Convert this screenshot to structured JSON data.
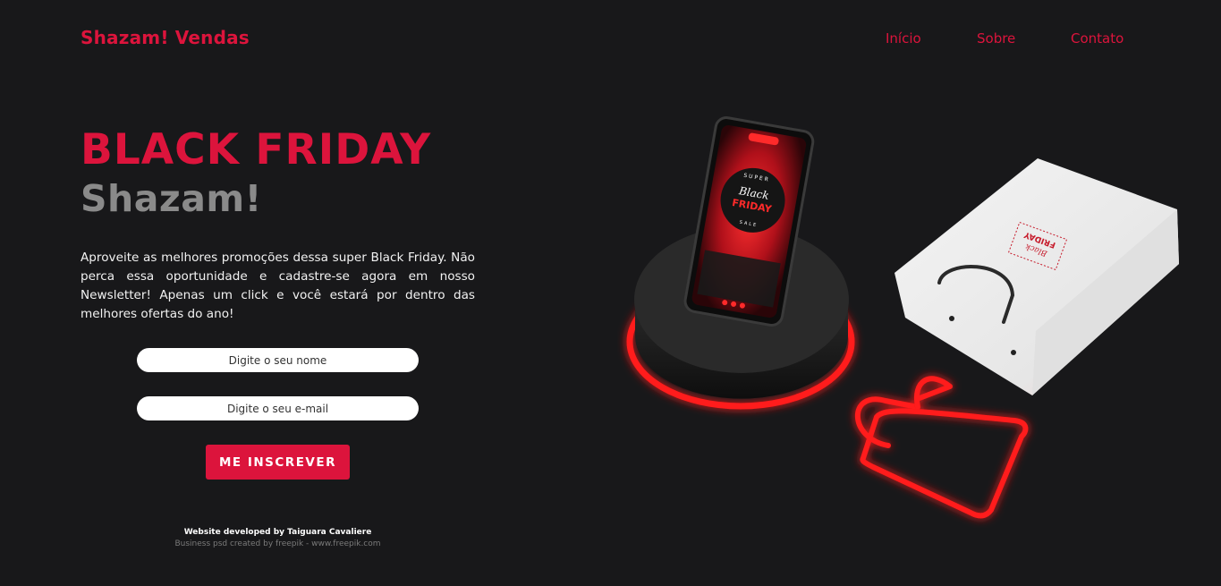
{
  "header": {
    "logo": "Shazam! Vendas",
    "nav": [
      {
        "label": "Início"
      },
      {
        "label": "Sobre"
      },
      {
        "label": "Contato"
      }
    ]
  },
  "hero": {
    "title": "BLACK FRIDAY",
    "subtitle": "Shazam!",
    "description": "Aproveite as melhores promoções dessa super Black Friday. Não perca essa oportunidade e cadastre-se agora em nosso Newsletter! Apenas um click e você estará por dentro das melhores ofertas do ano!"
  },
  "form": {
    "name_placeholder": "Digite o seu nome",
    "email_placeholder": "Digite o seu e-mail",
    "submit_label": "ME INSCREVER"
  },
  "footer": {
    "credit_dev": "Website developed by Taiguara Cavaliere",
    "credit_art": "Business psd created by freepik - www.freepik.com"
  },
  "illustration": {
    "phone_screen": {
      "top": "SUPER",
      "line1": "Black",
      "line2": "FRIDAY",
      "bottom": "SALE"
    },
    "bag_label": {
      "line1": "Black",
      "line2": "FRIDAY"
    }
  },
  "colors": {
    "background": "#18181a",
    "accent": "#dc143c",
    "muted": "#8a8a8a"
  },
  "icons": [
    "phone-illustration",
    "pedestal-illustration",
    "paper-bag-illustration",
    "neon-bag-icon"
  ]
}
